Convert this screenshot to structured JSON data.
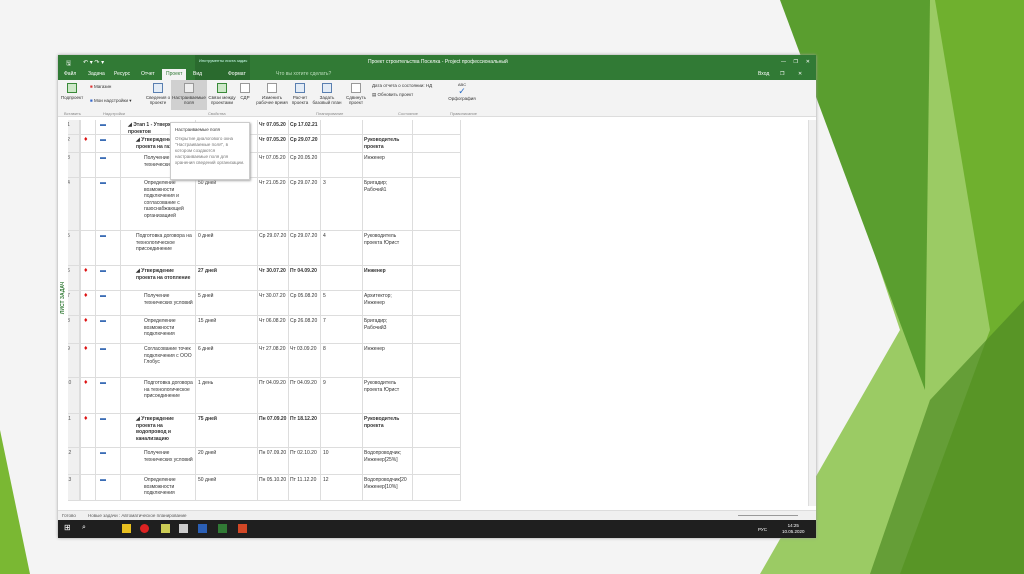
{
  "window": {
    "title": "Проект строительства Поселка - Project профессиональный",
    "context_tab": "Инструменты листа задач",
    "signin": "Вход",
    "tell_me": "Что вы хотите сделать?"
  },
  "tabs": [
    "Файл",
    "Задача",
    "Ресурс",
    "Отчет",
    "Проект",
    "Вид",
    "Формат"
  ],
  "ribbon": {
    "buttons": [
      "Подпроект",
      "Магазин",
      "Мои надстройки",
      "Сведения о проекте",
      "Настраиваемые поля",
      "Связи между проектами",
      "СДР",
      "Изменить рабочее время",
      "Расчет проекта",
      "Задать базовый план",
      "Сдвинуть проект",
      "Дата отчета о состоянии: НД",
      "Обновить проект",
      "Орфография"
    ],
    "groups": [
      "Вставить",
      "Надстройки",
      "Свойства",
      "Планирование",
      "Состояние",
      "Правописание"
    ]
  },
  "tooltip": {
    "title": "Настраиваемые поля",
    "text": "Открытие диалогового окна \"Настраиваемые поля\", в котором создаются настраиваемые поля для хранения сведений организации."
  },
  "side_label": "ЛИСТ ЗАДАЧ",
  "rows": [
    {
      "id": "1",
      "name": "◢ Этап 1 - Утверждение проектов",
      "dur": "",
      "start": "Чт 07.05.20",
      "finish": "Ср 17.02.21",
      "pred": "",
      "res": "",
      "bold": true,
      "ind": false,
      "lvl": 0
    },
    {
      "id": "2",
      "name": "◢ Утверждение проекта на газ",
      "dur": "",
      "start": "Чт 07.05.20",
      "finish": "Ср 29.07.20",
      "pred": "",
      "res": "Руководитель проекта",
      "bold": true,
      "ind": true,
      "lvl": 1
    },
    {
      "id": "3",
      "name": "Получение технических условий",
      "dur": "",
      "start": "Чт 07.05.20",
      "finish": "Ср 20.05.20",
      "pred": "",
      "res": "Инженер",
      "bold": false,
      "ind": false,
      "lvl": 2
    },
    {
      "id": "4",
      "name": "Определение возможности подключения и согласование с газоснабжающей организацией",
      "dur": "50 дней",
      "start": "Чт 21.05.20",
      "finish": "Ср 29.07.20",
      "pred": "3",
      "res": "Бригадир; Рабочий1",
      "bold": false,
      "ind": false,
      "lvl": 2
    },
    {
      "id": "5",
      "name": "Подготовка договора на технологическое присоединение",
      "dur": "0 дней",
      "start": "Ср 29.07.20",
      "finish": "Ср 29.07.20",
      "pred": "4",
      "res": "Руководитель проекта Юрист",
      "bold": false,
      "ind": false,
      "lvl": 1
    },
    {
      "id": "6",
      "name": "◢ Утверждение проекта на отопление",
      "dur": "27 дней",
      "start": "Чт 30.07.20",
      "finish": "Пт 04.09.20",
      "pred": "",
      "res": "Инженер",
      "bold": true,
      "ind": true,
      "lvl": 1
    },
    {
      "id": "7",
      "name": "Получение технических условий",
      "dur": "5 дней",
      "start": "Чт 30.07.20",
      "finish": "Ср 05.08.20",
      "pred": "5",
      "res": "Архитектор; Инженер",
      "bold": false,
      "ind": true,
      "lvl": 2
    },
    {
      "id": "8",
      "name": "Определение возможности подключения",
      "dur": "15 дней",
      "start": "Чт 06.08.20",
      "finish": "Ср 26.08.20",
      "pred": "7",
      "res": "Бригадир; Рабочий3",
      "bold": false,
      "ind": true,
      "lvl": 2
    },
    {
      "id": "9",
      "name": "Согласование точек подключения с ООО Глобус",
      "dur": "6 дней",
      "start": "Чт 27.08.20",
      "finish": "Чт 03.09.20",
      "pred": "8",
      "res": "Инженер",
      "bold": false,
      "ind": true,
      "lvl": 2
    },
    {
      "id": "10",
      "name": "Подготовка договора на технологическое присоединение",
      "dur": "1 день",
      "start": "Пт 04.09.20",
      "finish": "Пт 04.09.20",
      "pred": "9",
      "res": "Руководитель проекта Юрист",
      "bold": false,
      "ind": true,
      "lvl": 2
    },
    {
      "id": "11",
      "name": "◢ Утверждение проекта на водопровод и канализацию",
      "dur": "75 дней",
      "start": "Пн 07.09.20",
      "finish": "Пт 18.12.20",
      "pred": "",
      "res": "Руководитель проекта",
      "bold": true,
      "ind": true,
      "lvl": 1
    },
    {
      "id": "12",
      "name": "Получение технических условий",
      "dur": "20 дней",
      "start": "Пн 07.09.20",
      "finish": "Пт 02.10.20",
      "pred": "10",
      "res": "Водопроводчик; Инженер[25%]",
      "bold": false,
      "ind": false,
      "lvl": 2
    },
    {
      "id": "13",
      "name": "Определение возможности подключения",
      "dur": "50 дней",
      "start": "Пн 05.10.20",
      "finish": "Пт 11.12.20",
      "pred": "12",
      "res": "Водопроводчик[20 Инженер[10%]",
      "bold": false,
      "ind": false,
      "lvl": 2
    }
  ],
  "status": {
    "ready": "Готово",
    "new_tasks": "Новые задачи : Автоматическое планирование"
  },
  "taskbar": {
    "lang": "РУС",
    "time": "14:25",
    "date": "10.05.2020"
  },
  "colors": {
    "accent": "#317a35",
    "deco_green": "#7ab833"
  }
}
